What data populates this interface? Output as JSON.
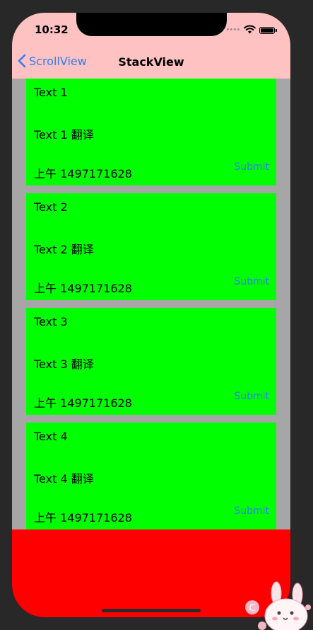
{
  "status_bar": {
    "time": "10:32"
  },
  "nav": {
    "back_label": "ScrollView",
    "title": "StackView"
  },
  "cards": [
    {
      "text": "Text 1",
      "translation": "Text 1 翻译",
      "time": "上午 1497171628",
      "button": "Submit"
    },
    {
      "text": "Text 2",
      "translation": "Text 2 翻译",
      "time": "上午 1497171628",
      "button": "Submit"
    },
    {
      "text": "Text 3",
      "translation": "Text 3 翻译",
      "time": "上午 1497171628",
      "button": "Submit"
    },
    {
      "text": "Text 4",
      "translation": "Text 4 翻译",
      "time": "上午 1497171628",
      "button": "Submit"
    }
  ],
  "colors": {
    "nav_background": "#FFC2C2",
    "card_background": "#00FF00",
    "scroll_background": "#A6A6A6",
    "footer_background": "#FF0000",
    "accent": "#2F7CF6"
  },
  "icons": {
    "back": "chevron-left-icon",
    "signal": "signal-dots-icon",
    "wifi": "wifi-icon",
    "battery": "battery-icon",
    "sticker": "bunny-sticker-icon"
  }
}
